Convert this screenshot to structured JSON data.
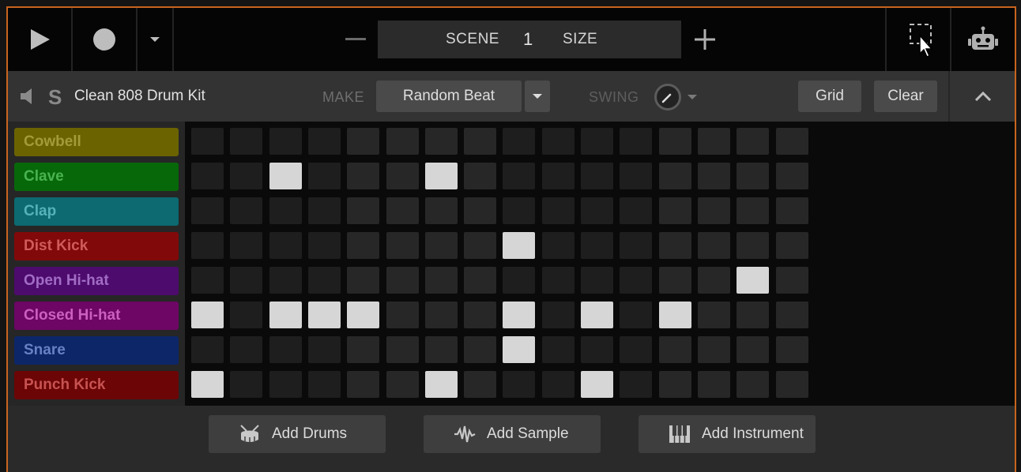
{
  "transport": {
    "scene_label": "SCENE",
    "scene_number": "1",
    "size_label": "SIZE"
  },
  "track": {
    "kit_name": "Clean 808 Drum Kit",
    "make_label": "MAKE",
    "random_beat_label": "Random Beat",
    "swing_label": "SWING",
    "grid_label": "Grid",
    "clear_label": "Clear"
  },
  "instruments": [
    {
      "name": "Cowbell",
      "bg": "#6b6300",
      "fg": "#a39b3a",
      "steps": []
    },
    {
      "name": "Clave",
      "bg": "#07680a",
      "fg": "#49b34f",
      "steps": [
        2,
        6
      ]
    },
    {
      "name": "Clap",
      "bg": "#0c6a70",
      "fg": "#55b2b8",
      "steps": []
    },
    {
      "name": "Dist Kick",
      "bg": "#820909",
      "fg": "#d05b5b",
      "steps": [
        8
      ]
    },
    {
      "name": "Open Hi-hat",
      "bg": "#4d0b6d",
      "fg": "#a16cc4",
      "steps": [
        14
      ]
    },
    {
      "name": "Closed Hi-hat",
      "bg": "#6d0664",
      "fg": "#cc5fc1",
      "steps": [
        0,
        2,
        3,
        4,
        8,
        10,
        12
      ]
    },
    {
      "name": "Snare",
      "bg": "#0c2668",
      "fg": "#6781c4",
      "steps": [
        8
      ]
    },
    {
      "name": "Punch Kick",
      "bg": "#6c0505",
      "fg": "#c85252",
      "steps": [
        0,
        6,
        10
      ]
    }
  ],
  "steps_per_row": 16,
  "colors": {
    "accent_border": "#c8641e",
    "cell_on": "#d6d6d6",
    "cell_off_dark": "#1e1e1e",
    "cell_off_light": "#272727"
  },
  "bottom": {
    "add_drums_label": "Add Drums",
    "add_sample_label": "Add Sample",
    "add_instrument_label": "Add Instrument"
  }
}
